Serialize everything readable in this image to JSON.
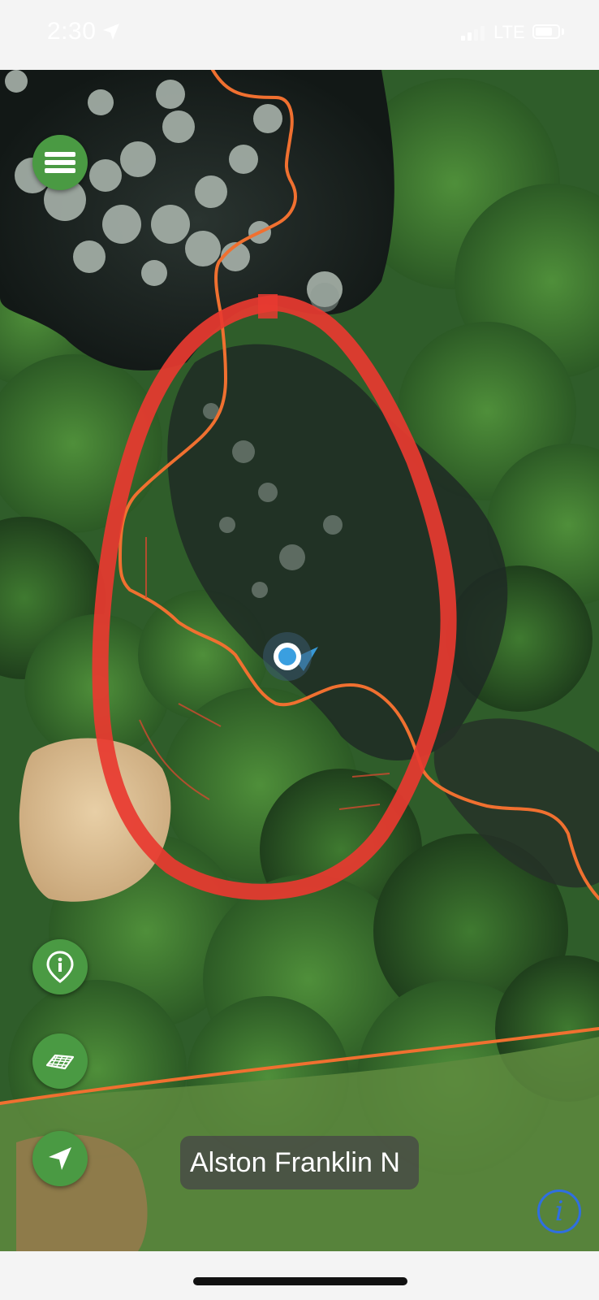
{
  "status_bar": {
    "time": "2:30",
    "network": "LTE",
    "battery_level": 0.75,
    "signal_bars": 2,
    "signal_bars_total": 4,
    "icons": [
      "location-arrow-icon",
      "signal-icon",
      "battery-icon"
    ]
  },
  "map": {
    "type": "satellite",
    "annotation_color": "#e83a30",
    "boundary_color": "#f07030",
    "location_dot_color": "#3a9fe0"
  },
  "controls": {
    "menu_icon": "hamburger-icon",
    "poi_icon": "map-pin-info-icon",
    "layers_icon": "map-layers-icon",
    "locate_icon": "navigation-arrow-icon",
    "button_color": "#4a9a43"
  },
  "place_label": "Alston Franklin N",
  "info_button": {
    "label": "i",
    "icon": "info-icon",
    "color": "#2f6fe0"
  }
}
